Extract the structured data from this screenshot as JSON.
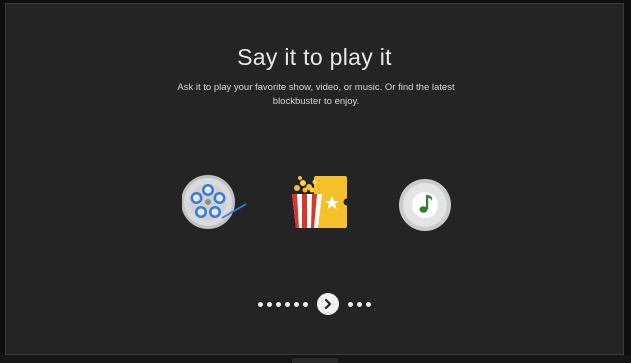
{
  "onboarding": {
    "title": "Say it to play it",
    "subtitle": "Ask it to play your favorite show, video, or music. Or find the latest blockbuster to enjoy."
  },
  "icons": [
    "film-reel-icon",
    "popcorn-ticket-icon",
    "music-note-icon"
  ],
  "pager": {
    "total_dots": 9,
    "current_index": 6,
    "button_icon": "chevron-right-icon"
  },
  "colors": {
    "background": "#242424",
    "reel": "#cfd0d0",
    "reel_accent": "#3a7bd5",
    "popcorn_red": "#d9362b",
    "ticket_yellow": "#f5c02a",
    "music_green": "#2e7d32"
  }
}
